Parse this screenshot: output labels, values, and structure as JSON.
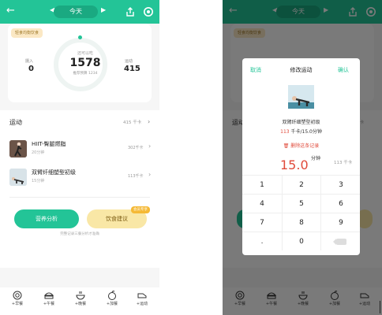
{
  "colors": {
    "accent": "#23c497",
    "highlight": "#e04a3a",
    "warning": "#f5b935"
  },
  "left": {
    "topbar": {
      "date": "今天",
      "back_icon": "back-arrow-icon",
      "share_icon": "share-icon",
      "settings_icon": "gear-icon"
    },
    "summary": {
      "tag": "轻食均衡饮食",
      "intake_label": "摄入",
      "intake_value": "0",
      "ring_top": "还可以吃",
      "ring_value": "1578",
      "ring_sub": "推荐预算 1234",
      "burn_label": "运动",
      "burn_value": "415",
      "progress": 0.0
    },
    "exercise": {
      "title": "运动",
      "total": "415 千卡",
      "items": [
        {
          "name": "HIIT-臀腿燃脂",
          "duration": "20分钟",
          "kcal": "302千卡"
        },
        {
          "name": "双臂纤细塑型初级",
          "duration": "15分钟",
          "kcal": "113千卡"
        }
      ]
    },
    "actions": {
      "nutrition": "营养分析",
      "diet": "饮食建议",
      "badge": "会员专享",
      "footnote": "完整记录三餐分析才准确"
    },
    "tabs": [
      {
        "label": "+早餐",
        "icon": "breakfast-icon"
      },
      {
        "label": "+午餐",
        "icon": "lunch-icon"
      },
      {
        "label": "+晚餐",
        "icon": "dinner-icon"
      },
      {
        "label": "+加餐",
        "icon": "snack-icon"
      },
      {
        "label": "+运动",
        "icon": "exercise-icon"
      }
    ]
  },
  "dialog": {
    "cancel": "取消",
    "title": "修改运动",
    "confirm": "确认",
    "exercise_name": "双臂纤细塑型初级",
    "kcal_value": "113",
    "kcal_suffix": " 千卡/15.0分钟",
    "delete": "删除这条记录",
    "amount": "15.0",
    "unit": "分钟",
    "kcal_side": "113 千卡",
    "keys": [
      "1",
      "2",
      "3",
      "4",
      "5",
      "6",
      "7",
      "8",
      "9",
      ".",
      "0",
      ""
    ]
  }
}
